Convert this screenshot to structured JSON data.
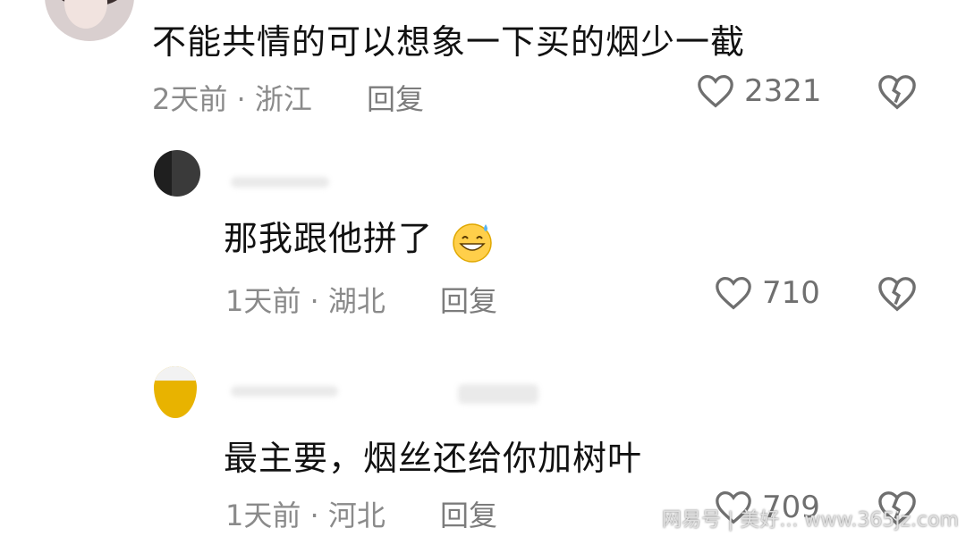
{
  "comments": [
    {
      "text": "不能共情的可以想象一下买的烟少一截",
      "time_location": "2天前 · 浙江",
      "reply_label": "回复",
      "likes": "2321"
    },
    {
      "text": "那我跟他拼了",
      "emoji": "grinning-sweat-emoji",
      "time_location": "1天前 · 湖北",
      "reply_label": "回复",
      "likes": "710"
    },
    {
      "text": "最主要，烟丝还给你加树叶",
      "time_location": "1天前 · 河北",
      "reply_label": "回复",
      "likes": "709"
    }
  ],
  "watermark": "网易号 | 美好... www.365jz.com",
  "icons": {
    "like": "heart-outline-icon",
    "dislike": "broken-heart-icon"
  }
}
